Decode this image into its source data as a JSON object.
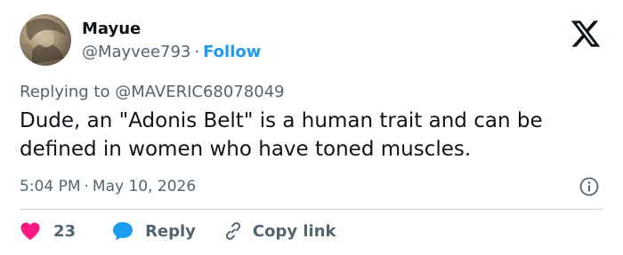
{
  "user": {
    "display_name": "Mayue",
    "handle": "@Mayvee793",
    "separator": "·",
    "follow_label": "Follow"
  },
  "reply_context": {
    "prefix": "Replying to",
    "mention": "@MAVERIC68078049"
  },
  "tweet": {
    "text": "Dude, an \"Adonis Belt\" is a human trait and can be defined in women who have toned muscles.",
    "time": "5:04 PM",
    "separator": "·",
    "date": "May 10, 2026"
  },
  "actions": {
    "like_count": "23",
    "reply_label": "Reply",
    "copy_link_label": "Copy link"
  },
  "icons": {
    "logo": "x-logo-icon",
    "info": "info-icon",
    "like": "heart-icon",
    "reply": "speech-bubble-icon",
    "copy": "link-icon"
  },
  "colors": {
    "text_primary": "#0f1419",
    "text_secondary": "#536471",
    "follow": "#1d9bf0",
    "heart": "#f91880",
    "reply_bubble": "#1d9bf0",
    "divider": "#cfd9de"
  }
}
